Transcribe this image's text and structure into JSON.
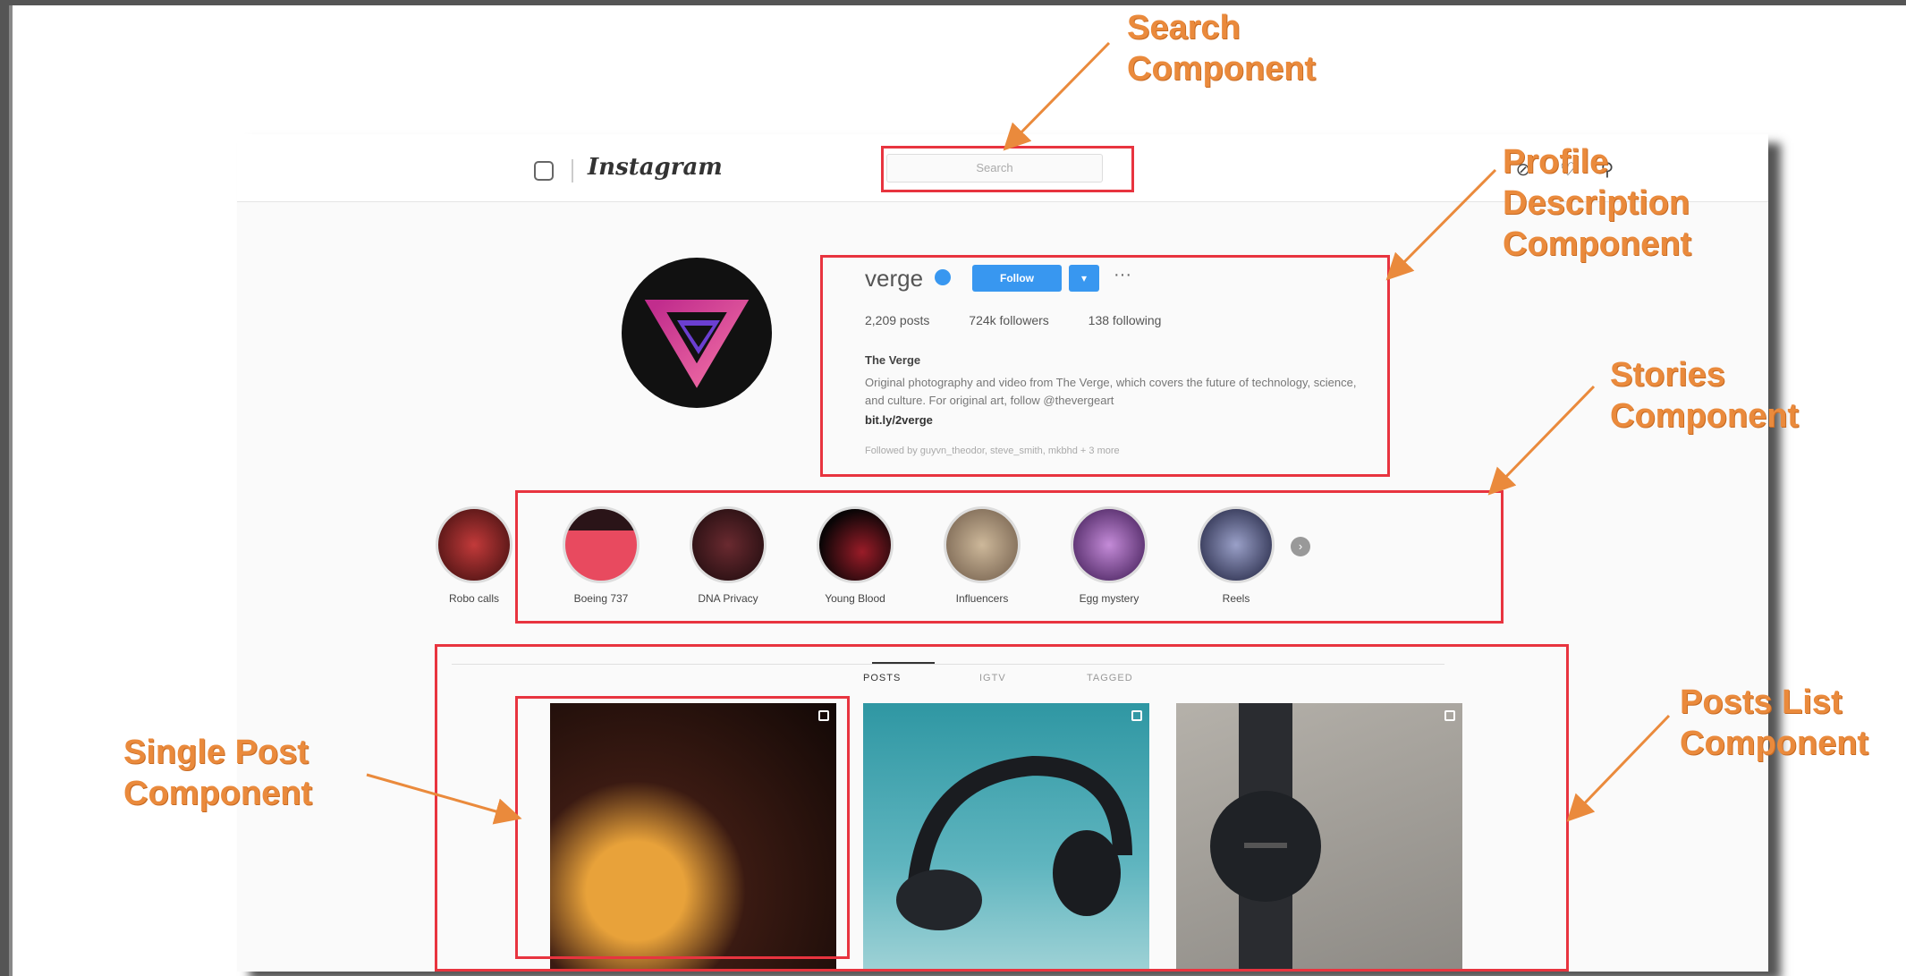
{
  "annotations": {
    "search": [
      "Search",
      "Component"
    ],
    "profile": [
      "Profile",
      "Description",
      "Component"
    ],
    "stories": [
      "Stories",
      "Component"
    ],
    "posts_list": [
      "Posts List",
      "Component"
    ],
    "single_post": [
      "Single Post",
      "Component"
    ],
    "accent_color": "#ea8a3c",
    "box_color": "#e8343f"
  },
  "instagram": {
    "wordmark": "Instagram",
    "search_placeholder": "Search",
    "profile": {
      "username": "verge",
      "follow_label": "Follow",
      "dropdown_label": "▾",
      "more_label": "···",
      "stats": [
        "2,209 posts",
        "724k followers",
        "138 following"
      ],
      "bio_name": "The Verge",
      "bio_text": "Original photography and video from The Verge, which covers the future of technology, science, and culture. For original art, follow @thevergeart",
      "bio_link": "bit.ly/2verge",
      "followed_by": "Followed by guyvn_theodor, steve_smith, mkbhd + 3 more"
    },
    "stories": [
      "Robo calls",
      "Boeing 737",
      "DNA Privacy",
      "Young Blood",
      "Influencers",
      "Egg mystery",
      "Reels"
    ],
    "tabs": [
      "POSTS",
      "IGTV",
      "TAGGED"
    ]
  }
}
